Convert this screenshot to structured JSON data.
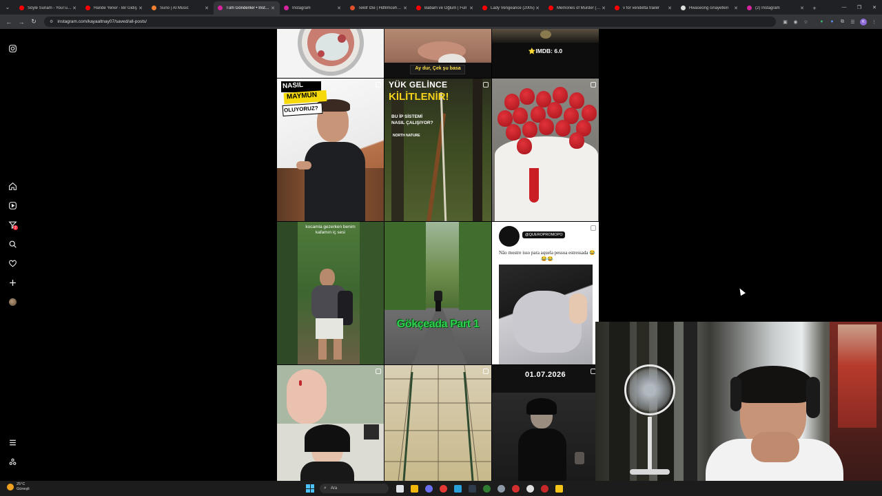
{
  "browser": {
    "tabs": [
      {
        "title": "Söyle Sunam - YouTube",
        "color": "#ff0000"
      },
      {
        "title": "Hande Yener - Bir Gidiş",
        "color": "#ff0000"
      },
      {
        "title": "Suno | AI Music",
        "color": "#f08030"
      },
      {
        "title": "Tüm Gönderiler • Instagram",
        "color": "#d6249f",
        "active": true
      },
      {
        "title": "Instagram",
        "color": "#d6249f"
      },
      {
        "title": "Teklif İzle | Hdfilmcehennemi",
        "color": "#e0502a"
      },
      {
        "title": "Babam ve Oğlum | Full",
        "color": "#ff0000"
      },
      {
        "title": "Lady Vengeance (2005)",
        "color": "#ff0000"
      },
      {
        "title": "Memories of Murder (2003)",
        "color": "#ff0000"
      },
      {
        "title": "v for vendetta trailer",
        "color": "#ff0000"
      },
      {
        "title": "Hwaseong cinayetleri",
        "color": "#dddddd"
      },
      {
        "title": "(2) Instagram",
        "color": "#d6249f"
      }
    ],
    "url": "instagram.com/kayaaltnay07/saved/all-posts/"
  },
  "instagram": {
    "rail": [
      {
        "name": "instagram-logo-icon"
      },
      {
        "name": "home-icon"
      },
      {
        "name": "reels-icon"
      },
      {
        "name": "explore-icon",
        "badge": "2"
      },
      {
        "name": "search-icon"
      },
      {
        "name": "notifications-heart-icon"
      },
      {
        "name": "create-plus-icon"
      },
      {
        "name": "profile-avatar"
      },
      {
        "name": "more-menu-icon"
      },
      {
        "name": "threads-icon"
      }
    ],
    "posts": {
      "imdb_caption": "⭐IMDB: 6.0",
      "subtitle_caption": "Ay dur, Çek şu basa",
      "post_nasil": [
        "NASIL",
        "MAYMUN",
        "OLUYORUZ?"
      ],
      "post_rope_title": [
        "YÜK GELİNCE",
        "KİLİTLENİR!"
      ],
      "post_rope_sub": [
        "BU İP SİSTEMİ",
        "NASIL ÇALIŞIYOR?"
      ],
      "post_rope_brand": "NORTH NATURE",
      "post_forest_caption": [
        "kocamla gezerken benim",
        "kafamın iç sesi"
      ],
      "post_gokceada": "Gökçeada Part 1",
      "post_towel_handle": "@QUEROPROMOPO",
      "post_towel_caption": "Não mostre isso para aquela pessoa estressada 😂😂😂",
      "post_date": "01.07.2026"
    }
  },
  "taskbar": {
    "temperature": "25°C",
    "weather": "Güneşli",
    "search_placeholder": "Ara"
  }
}
